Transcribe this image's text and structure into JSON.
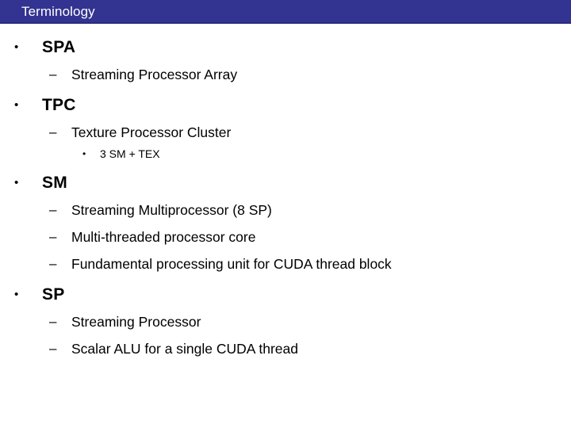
{
  "slide": {
    "title": "Terminology",
    "title_bar_color": "#333391",
    "title_text_color": "#ffffff",
    "background_color": "#ffffff",
    "text_color": "#000000"
  },
  "markers": {
    "level1": "•",
    "level2": "–",
    "level3": "•"
  },
  "outline": [
    {
      "level": 1,
      "text": "SPA",
      "children": [
        {
          "level": 2,
          "text": "Streaming Processor Array"
        }
      ]
    },
    {
      "level": 1,
      "text": "TPC",
      "children": [
        {
          "level": 2,
          "text": "Texture Processor Cluster"
        },
        {
          "level": 3,
          "text": "3 SM + TEX"
        }
      ]
    },
    {
      "level": 1,
      "text": "SM",
      "children": [
        {
          "level": 2,
          "text": "Streaming Multiprocessor (8 SP)"
        },
        {
          "level": 2,
          "text": "Multi-threaded processor core"
        },
        {
          "level": 2,
          "text": "Fundamental processing unit for CUDA thread block"
        }
      ]
    },
    {
      "level": 1,
      "text": "SP",
      "children": [
        {
          "level": 2,
          "text": "Streaming Processor"
        },
        {
          "level": 2,
          "text": "Scalar ALU for a single CUDA thread"
        }
      ]
    }
  ],
  "lines": [
    {
      "id": "l1-spa",
      "level": 1,
      "text": "SPA"
    },
    {
      "id": "l2-spa-1",
      "level": 2,
      "text": "Streaming Processor Array"
    },
    {
      "id": "l1-tpc",
      "level": 1,
      "text": "TPC"
    },
    {
      "id": "l2-tpc-1",
      "level": 2,
      "text": "Texture Processor Cluster"
    },
    {
      "id": "l3-tpc-1",
      "level": 3,
      "text": "3 SM + TEX"
    },
    {
      "id": "l1-sm",
      "level": 1,
      "text": "SM"
    },
    {
      "id": "l2-sm-1",
      "level": 2,
      "text": "Streaming Multiprocessor (8 SP)"
    },
    {
      "id": "l2-sm-2",
      "level": 2,
      "text": "Multi-threaded processor core"
    },
    {
      "id": "l2-sm-3",
      "level": 2,
      "text": "Fundamental processing unit for CUDA thread block"
    },
    {
      "id": "l1-sp",
      "level": 1,
      "text": "SP"
    },
    {
      "id": "l2-sp-1",
      "level": 2,
      "text": "Streaming Processor"
    },
    {
      "id": "l2-sp-2",
      "level": 2,
      "text": "Scalar ALU for a single CUDA thread"
    }
  ]
}
